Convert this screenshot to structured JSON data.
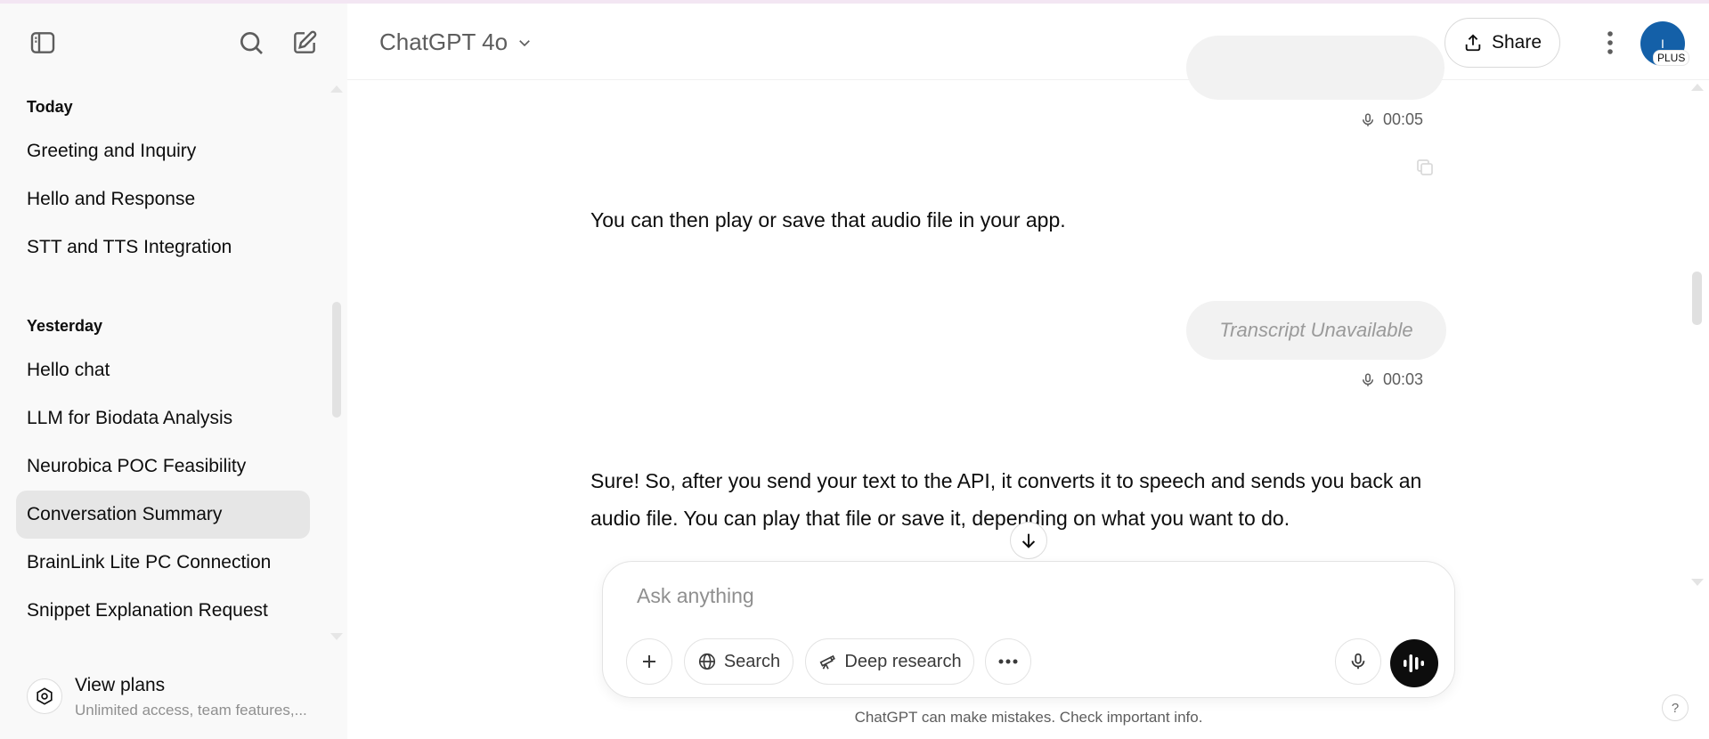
{
  "sidebar": {
    "sections": [
      {
        "title": "Today",
        "items": [
          "Greeting and Inquiry",
          "Hello and Response",
          "STT and TTS Integration"
        ]
      },
      {
        "title": "Yesterday",
        "items": [
          "Hello chat",
          "LLM for Biodata Analysis",
          "Neurobica POC Feasibility",
          "Conversation Summary",
          "BrainLink Lite PC Connection",
          "Snippet Explanation Request"
        ]
      }
    ],
    "active_item": "Conversation Summary",
    "view_plans": {
      "title": "View plans",
      "subtitle": "Unlimited access, team features,..."
    }
  },
  "header": {
    "model_title": "ChatGPT 4o",
    "share_label": "Share",
    "avatar_initial": "I",
    "plan_badge": "PLUS"
  },
  "conversation": {
    "audio_durations": [
      "00:05",
      "00:03"
    ],
    "assistant_message_1": "You can then play or save that audio file in your app.",
    "user_bubble_text": "Transcript Unavailable",
    "assistant_message_2": "Sure! So, after you send your text to the API, it converts it to speech and sends you back an audio file. You can play that file or save it, depending on what you want to do."
  },
  "composer": {
    "placeholder": "Ask anything",
    "search_label": "Search",
    "deep_research_label": "Deep research"
  },
  "disclaimer": "ChatGPT can make mistakes. Check important info.",
  "help_label": "?",
  "colors": {
    "avatar_bg": "#1460a8",
    "sidebar_bg": "#f9f9f9",
    "active_item_bg": "#e6e6e6",
    "bubble_bg": "#f2f2f2"
  }
}
